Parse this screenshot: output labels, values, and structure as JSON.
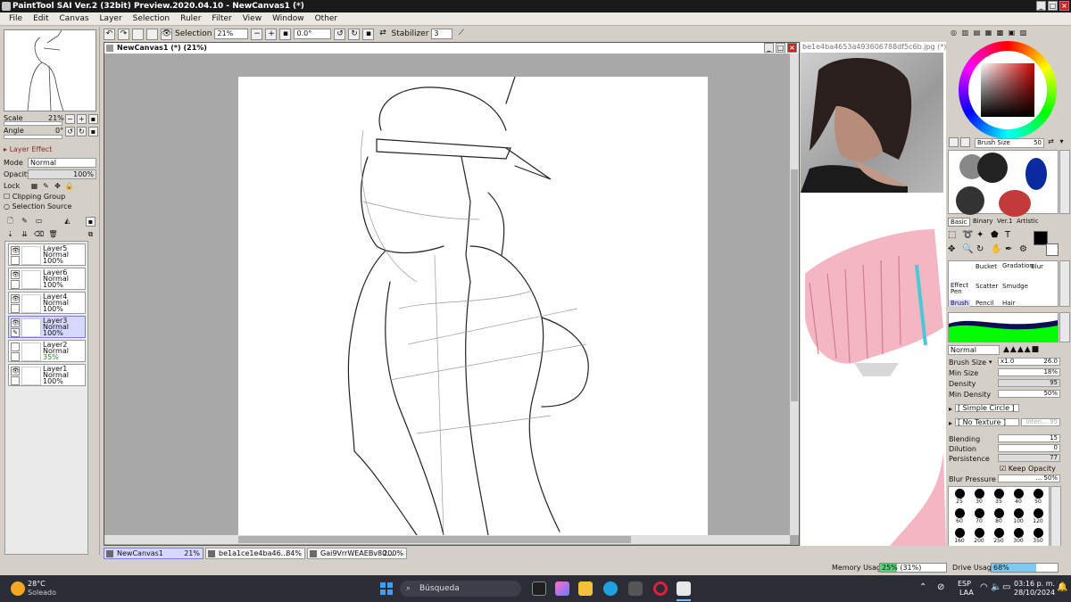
{
  "window": {
    "title": "PaintTool SAI Ver.2 (32bit) Preview.2020.04.10 - NewCanvas1 (*)"
  },
  "menu": [
    "File",
    "Edit",
    "Canvas",
    "Layer",
    "Selection",
    "Ruler",
    "Filter",
    "View",
    "Window",
    "Other"
  ],
  "toolbar": {
    "selection_label": "Selection",
    "zoom": "21%",
    "angle": "0.0°",
    "stabilizer_label": "Stabilizer",
    "stabilizer_value": "3"
  },
  "navigator": {
    "scale_label": "Scale",
    "scale_value": "21%",
    "angle_label": "Angle",
    "angle_value": "0°"
  },
  "layer_panel": {
    "effect_label": "Layer Effect",
    "mode_label": "Mode",
    "mode_value": "Normal",
    "opacity_label": "Opacity",
    "opacity_value": "100%",
    "lock_label": "Lock",
    "clipping_label": "Clipping Group",
    "selection_source_label": "Selection Source",
    "layers": [
      {
        "name": "Layer5",
        "mode": "Normal",
        "opacity": "100%"
      },
      {
        "name": "Layer6",
        "mode": "Normal",
        "opacity": "100%"
      },
      {
        "name": "Layer4",
        "mode": "Normal",
        "opacity": "100%"
      },
      {
        "name": "Layer3",
        "mode": "Normal",
        "opacity": "100%"
      },
      {
        "name": "Layer2",
        "mode": "Normal",
        "opacity": "35%"
      },
      {
        "name": "Layer1",
        "mode": "Normal",
        "opacity": "100%"
      }
    ]
  },
  "canvas": {
    "title": "NewCanvas1 (*) (21%)"
  },
  "reference": {
    "title": "be1e4ba4653a493606788df5c6b.jpg (*)..."
  },
  "brush_panel": {
    "brush_size_label": "Brush Size",
    "brush_size_top": "50",
    "tabs": [
      "Basic",
      "Binary",
      "Ver.1",
      "Artistic"
    ],
    "tools": [
      "Bucket",
      "Gradation",
      "Blur",
      "Effect Pen",
      "Scatter",
      "Smudge",
      "Brush",
      "Pencil",
      "Hair"
    ],
    "blend_mode": "Normal",
    "brush_size_mult": "x1.0",
    "brush_size_value": "26.0",
    "min_size_label": "Min Size",
    "min_size_value": "18%",
    "density_label": "Density",
    "density_value": "95",
    "min_density_label": "Min Density",
    "min_density_value": "50%",
    "shape": "[ Simple Circle ]",
    "texture": "[ No Texture ]",
    "texture_intensity": "Inten... 95",
    "blending_label": "Blending",
    "blending_value": "15",
    "dilution_label": "Dilution",
    "dilution_value": "0",
    "persistence_label": "Persistence",
    "persistence_value": "77",
    "keep_opacity_label": "Keep Opacity",
    "blur_pressure_label": "Blur Pressure",
    "blur_pressure_value": "... 50%",
    "size_presets": [
      "25",
      "30",
      "35",
      "40",
      "50",
      "60",
      "70",
      "80",
      "100",
      "120",
      "160",
      "200",
      "250",
      "300",
      "350"
    ]
  },
  "doc_tabs": [
    {
      "name": "NewCanvas1",
      "zoom": "21%"
    },
    {
      "name": "be1a1ce1e4ba46...",
      "zoom": "84%"
    },
    {
      "name": "Gai9VrrWEAEBv80...",
      "zoom": "200%"
    }
  ],
  "status": {
    "memory_label": "Memory Usage",
    "memory_value": "25% (31%)",
    "memory_fraction": 0.25,
    "drive_label": "Drive Usage",
    "drive_value": "68%",
    "drive_fraction": 0.68
  },
  "taskbar": {
    "weather_temp": "28°C",
    "weather_desc": "Soleado",
    "search_placeholder": "Búsqueda",
    "lang": "ESP",
    "lang2": "LAA",
    "time": "03:16 p. m.",
    "date": "28/10/2024"
  },
  "colors": {
    "accent": "#d6d8ff",
    "memory": "#5cd27a",
    "drive": "#7fc8ef",
    "taskbar": "#2b2d36",
    "primary_color": "#000000"
  }
}
